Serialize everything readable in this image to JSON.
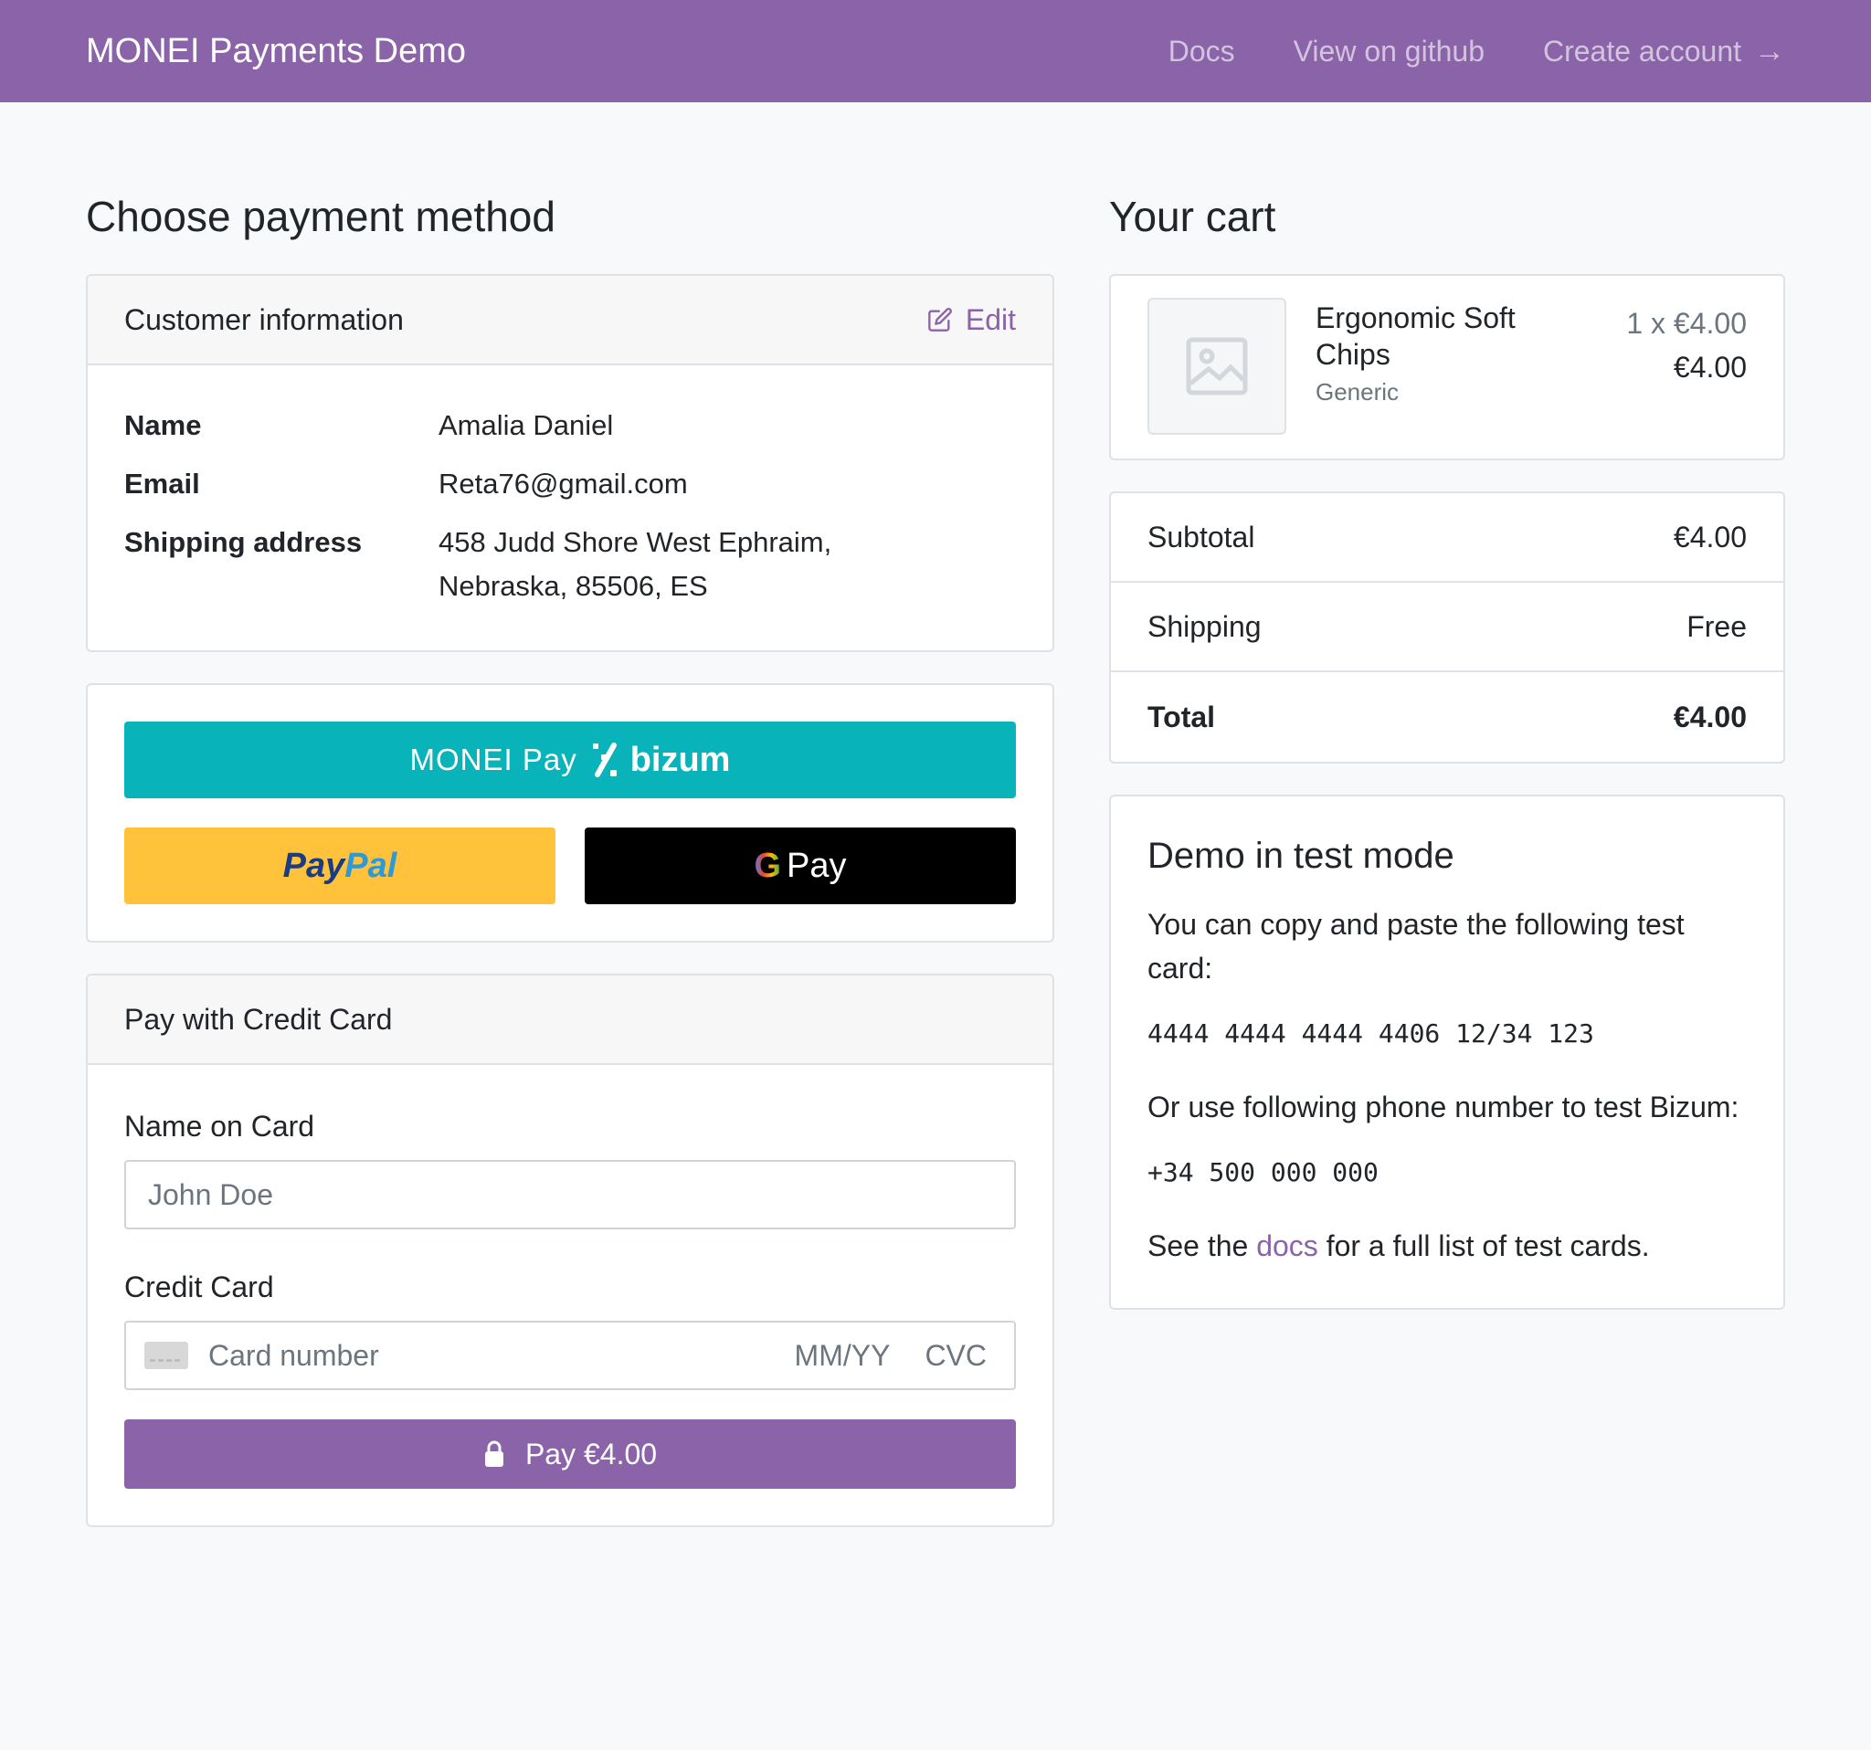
{
  "navbar": {
    "brand": "MONEI Payments Demo",
    "links": [
      "Docs",
      "View on github",
      "Create account"
    ],
    "arrow": "→"
  },
  "left": {
    "title": "Choose payment method",
    "customer": {
      "header": "Customer information",
      "edit_label": "Edit",
      "name_label": "Name",
      "name_value": "Amalia Daniel",
      "email_label": "Email",
      "email_value": "Reta76@gmail.com",
      "address_label": "Shipping address",
      "address_value": "458 Judd Shore West Ephraim, Nebraska, 85506, ES"
    },
    "wallets": {
      "bizum_prefix": "MONEI Pay",
      "bizum_brand": "bizum",
      "paypal_part1": "Pay",
      "paypal_part2": "Pal",
      "gpay_g": "G",
      "gpay_label": "Pay"
    },
    "credit_card": {
      "header": "Pay with Credit Card",
      "name_label": "Name on Card",
      "name_placeholder": "John Doe",
      "card_label": "Credit Card",
      "card_number_placeholder": "Card number",
      "expiry_placeholder": "MM/YY",
      "cvc_placeholder": "CVC",
      "pay_button": "Pay €4.00"
    }
  },
  "right": {
    "title": "Your cart",
    "item": {
      "name": "Ergonomic Soft Chips",
      "brand": "Generic",
      "qty_price": "1 x €4.00",
      "total": "€4.00"
    },
    "totals": {
      "subtotal_label": "Subtotal",
      "subtotal_value": "€4.00",
      "shipping_label": "Shipping",
      "shipping_value": "Free",
      "total_label": "Total",
      "total_value": "€4.00"
    },
    "demo": {
      "title": "Demo in test mode",
      "p1": "You can copy and paste the following test card:",
      "card": "4444 4444 4444 4406 12/34 123",
      "p2": "Or use following phone number to test Bizum:",
      "phone": "+34 500 000 000",
      "p3_before": "See the",
      "p3_link": "docs",
      "p3_after": "for a full list of test cards."
    }
  },
  "colors": {
    "brand": "#8a63a8",
    "bizum": "#08b3b9",
    "paypal": "#ffc23a"
  }
}
